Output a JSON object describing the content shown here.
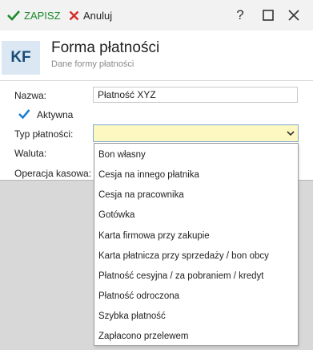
{
  "toolbar": {
    "save_label": "ZAPISZ",
    "cancel_label": "Anuluj",
    "help_label": "?"
  },
  "header": {
    "badge": "KF",
    "title": "Forma płatności",
    "subtitle": "Dane formy płatności"
  },
  "form": {
    "name_label": "Nazwa:",
    "name_value": "Płatność XYZ",
    "active_label": "Aktywna",
    "active_checked": true,
    "type_label": "Typ płatności:",
    "type_value": "",
    "currency_label": "Waluta:",
    "cash_operation_label": "Operacja kasowa:"
  },
  "dropdown": {
    "options": [
      "Bon własny",
      "Cesja na innego płatnika",
      "Cesja na pracownika",
      "Gotówka",
      "Karta firmowa przy zakupie",
      "Karta płatnicza przy sprzedaży / bon obcy",
      "Płatność cesyjna / za pobraniem / kredyt",
      "Płatność odroczona",
      "Szybka płatność",
      "Zapłacono przelewem"
    ]
  },
  "colors": {
    "save_green": "#1a8a2a",
    "cancel_red": "#d82a2a",
    "check_blue": "#1a7fd4",
    "select_bg": "#fdf8c2",
    "badge_bg": "#dbe8f3"
  },
  "icons": {
    "save": "check-icon",
    "cancel": "x-icon",
    "help": "question-icon",
    "maximize": "square-icon",
    "close": "close-icon",
    "dropdown": "chevron-down-icon"
  }
}
